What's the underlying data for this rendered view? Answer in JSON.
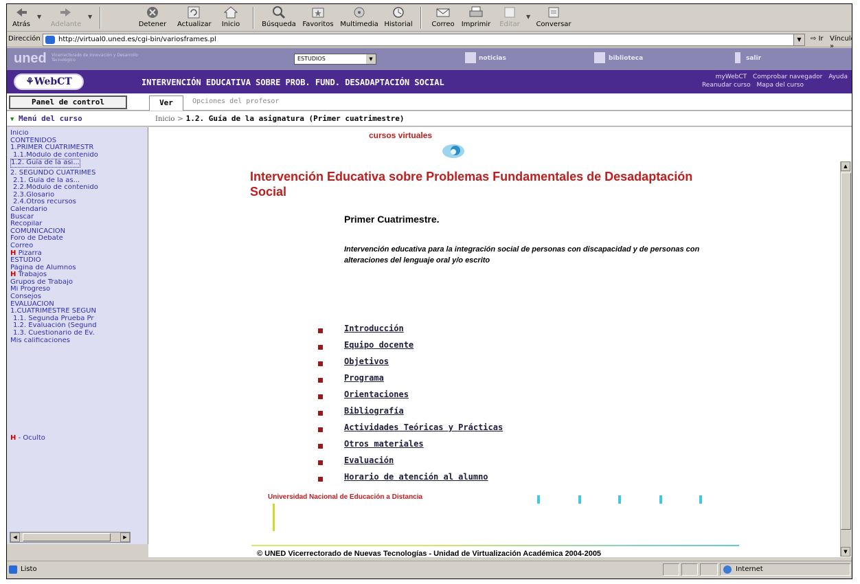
{
  "toolbar": {
    "back": "Atrás",
    "forward": "Adelante",
    "stop": "Detener",
    "refresh": "Actualizar",
    "home": "Inicio",
    "search": "Búsqueda",
    "favorites": "Favoritos",
    "media": "Multimedia",
    "history": "Historial",
    "mail": "Correo",
    "print": "Imprimir",
    "edit": "Editar",
    "discuss": "Conversar"
  },
  "address": {
    "label": "Dirección",
    "url": "http://virtual0.uned.es/cgi-bin/variosframes.pl",
    "go": "Ir",
    "links": "Vínculos »"
  },
  "uned_bar": {
    "logo": "uned",
    "subtitle": "Vicerrectorado de Innovación y Desarrollo Tecnológico",
    "select_value": "ESTUDIOS",
    "noticias": "noticias",
    "biblioteca": "biblioteca",
    "salir": "salir"
  },
  "header": {
    "logo": "WebCT",
    "course_title": "INTERVENCIÓN EDUCATIVA SOBRE PROB. FUND. DESADAPTACIÓN SOCIAL",
    "links_row1": [
      "myWebCT",
      "Comprobar navegador",
      "Ayuda"
    ],
    "links_row2": [
      "Reanudar curso",
      "Mapa del curso"
    ]
  },
  "tabs": {
    "panel": "Panel de control",
    "ver": "Ver",
    "opciones": "Opciones del profesor"
  },
  "menu": {
    "title": "Menú del curso",
    "items": [
      "Inicio",
      "CONTENIDOS",
      "1.PRIMER CUATRIMESTR",
      " 1.1.Módulo de contenido",
      " 1.2. Guía de la asi...",
      "2. SEGUNDO CUATRIMES",
      " 2.1. Guía de la as...",
      " 2.2.Módulo de contenido",
      " 2.3.Glosario",
      " 2.4.Otros recursos",
      "Calendario",
      "Buscar",
      "Recopilar",
      "COMUNICACIÓN",
      "Foro de Debate",
      "Correo",
      "Pizarra",
      "ESTUDIO",
      "Página de Alumnos",
      "Trabajos",
      "Grupos de Trabajo",
      "Mi Progreso",
      "Consejos",
      "EVALUACIÓN",
      "1.CUATRIMESTRE SEGUN",
      " 1.1. Segunda Prueba Pr",
      " 1.2. Evaluación (Segund",
      " 1.3. Cuestionario de Ev.",
      "Mis calificaciones"
    ],
    "h_marker": "H",
    "ocultar": "- Oculto"
  },
  "breadcrumb": {
    "home": "Inicio",
    "sep": ">",
    "current": "1.2. Guía de la asignatura (Primer cuatrimestre)"
  },
  "content": {
    "logo_text": "cursos virtuales",
    "title": "Intervención Educativa sobre Problemas Fundamentales de Desadaptación Social",
    "subtitle": "Primer Cuatrimestre.",
    "description": "Intervención educativa para la integración social de personas con discapacidad y de personas con alteraciones del lenguaje oral y/o escrito",
    "links": [
      "Introducción",
      "Equipo docente",
      "Objetivos",
      "Programa",
      "Orientaciones",
      "Bibliografía",
      "Actividades Teóricas y Prácticas",
      "Otros materiales",
      "Evaluación",
      "Horario de atención al alumno"
    ],
    "university": "Universidad Nacional de Educación a Distancia",
    "footer": "© UNED Vicerrectorado de Nuevas Tecnologías - Unidad de Virtualización Académica 2004-2005"
  },
  "status": {
    "text": "Listo",
    "zone": "Internet"
  }
}
